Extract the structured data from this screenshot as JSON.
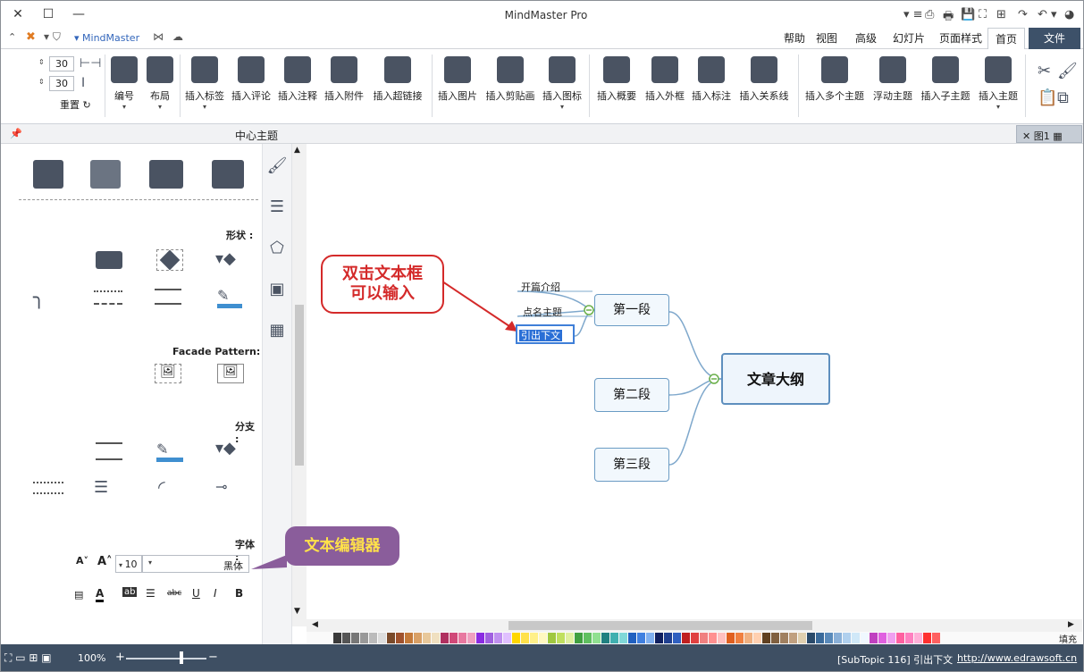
{
  "app": {
    "title": "MindMaster Pro",
    "brand": "MindMaster"
  },
  "tabs": [
    "文件",
    "首页",
    "页面样式",
    "幻灯片",
    "高级",
    "视图",
    "帮助"
  ],
  "active_tab": "首页",
  "ribbon": {
    "groups": {
      "clipboard": [
        "剪切",
        "复制",
        "粘贴"
      ],
      "insert_topic": "插入主题",
      "insert_subtopic": "插入子主题",
      "floating_topic": "浮动主题",
      "multi_topic": "插入多个主题",
      "relation": "插入关系线",
      "callout": "插入标注",
      "boundary": "插入外框",
      "summary": "插入概要",
      "icon": "插入图标",
      "clipart": "插入剪贴画",
      "image": "插入图片",
      "hyperlink": "插入超链接",
      "attachment": "插入附件",
      "note": "插入注释",
      "comment": "插入评论",
      "tag": "插入标签",
      "layout": "布局",
      "numbering": "编号",
      "reset": "重置",
      "spacing_h": "30",
      "spacing_v": "30"
    }
  },
  "header2": {
    "center_label": "中心主题",
    "doc_tab": "图1"
  },
  "left_panel": {
    "sections": {
      "shape": "形状 :",
      "facade": "Facade Pattern:",
      "branch": "分支 :",
      "font": "字体 :"
    },
    "font_name": "黑体",
    "font_size": "10",
    "format_buttons": [
      "B",
      "I",
      "U",
      "abc",
      "ab"
    ]
  },
  "mindmap": {
    "center": "文章大纲",
    "sections": [
      "第一段",
      "第二段",
      "第三段"
    ],
    "subtopics": [
      "开篇介绍",
      "点名主题",
      "引出下文"
    ],
    "editing_text": "引出下文"
  },
  "callouts": {
    "red": "双击文本框\n可以输入",
    "purple": "文本编辑器"
  },
  "status": {
    "url": "http://www.edrawsoft.cn",
    "topic_info": "[SubTopic 116]  引出下文",
    "fill_label": "填充",
    "zoom": "100%"
  },
  "colors": {
    "accent": "#3d5169",
    "node_border": "#6a9bc4",
    "red_callout": "#d42a2a",
    "purple_callout": "#8a5d9b"
  }
}
